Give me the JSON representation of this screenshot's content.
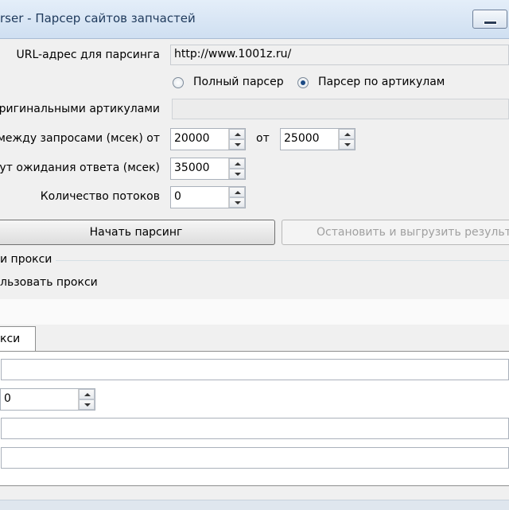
{
  "window": {
    "title": "rser - Парсер сайтов запчастей"
  },
  "form": {
    "url_label": "URL-адрес для парсинга",
    "url_value": "http://www.1001z.ru/",
    "radio_full_label": "Полный парсер",
    "radio_articles_label": "Парсер по артикулам",
    "radio_selected": "articles",
    "original_articles_label": "ригинальными артикулами",
    "original_articles_value": "",
    "delay_label": "между запросами (мсек) от",
    "delay_from": "20000",
    "delay_to_label": "от",
    "delay_to": "25000",
    "timeout_label": "аут ожидания ответа (мсек)",
    "timeout_value": "35000",
    "threads_label": "Количество потоков",
    "threads_value": "0",
    "start_button": "Начать парсинг",
    "stop_button": "Остановить и выгрузить результа"
  },
  "proxy": {
    "group_label": "и прокси",
    "use_label": "льзовать прокси",
    "tab_label": "кси",
    "field1_value": "",
    "spin_value": "0",
    "field2_value": "",
    "field3_value": ""
  },
  "colors": {
    "title_text": "#1e395b",
    "titlebar": "#cfdff1",
    "background": "#f0f0f0",
    "disabled_text": "#a0a0a0",
    "radio_dot": "#1c4a84"
  }
}
